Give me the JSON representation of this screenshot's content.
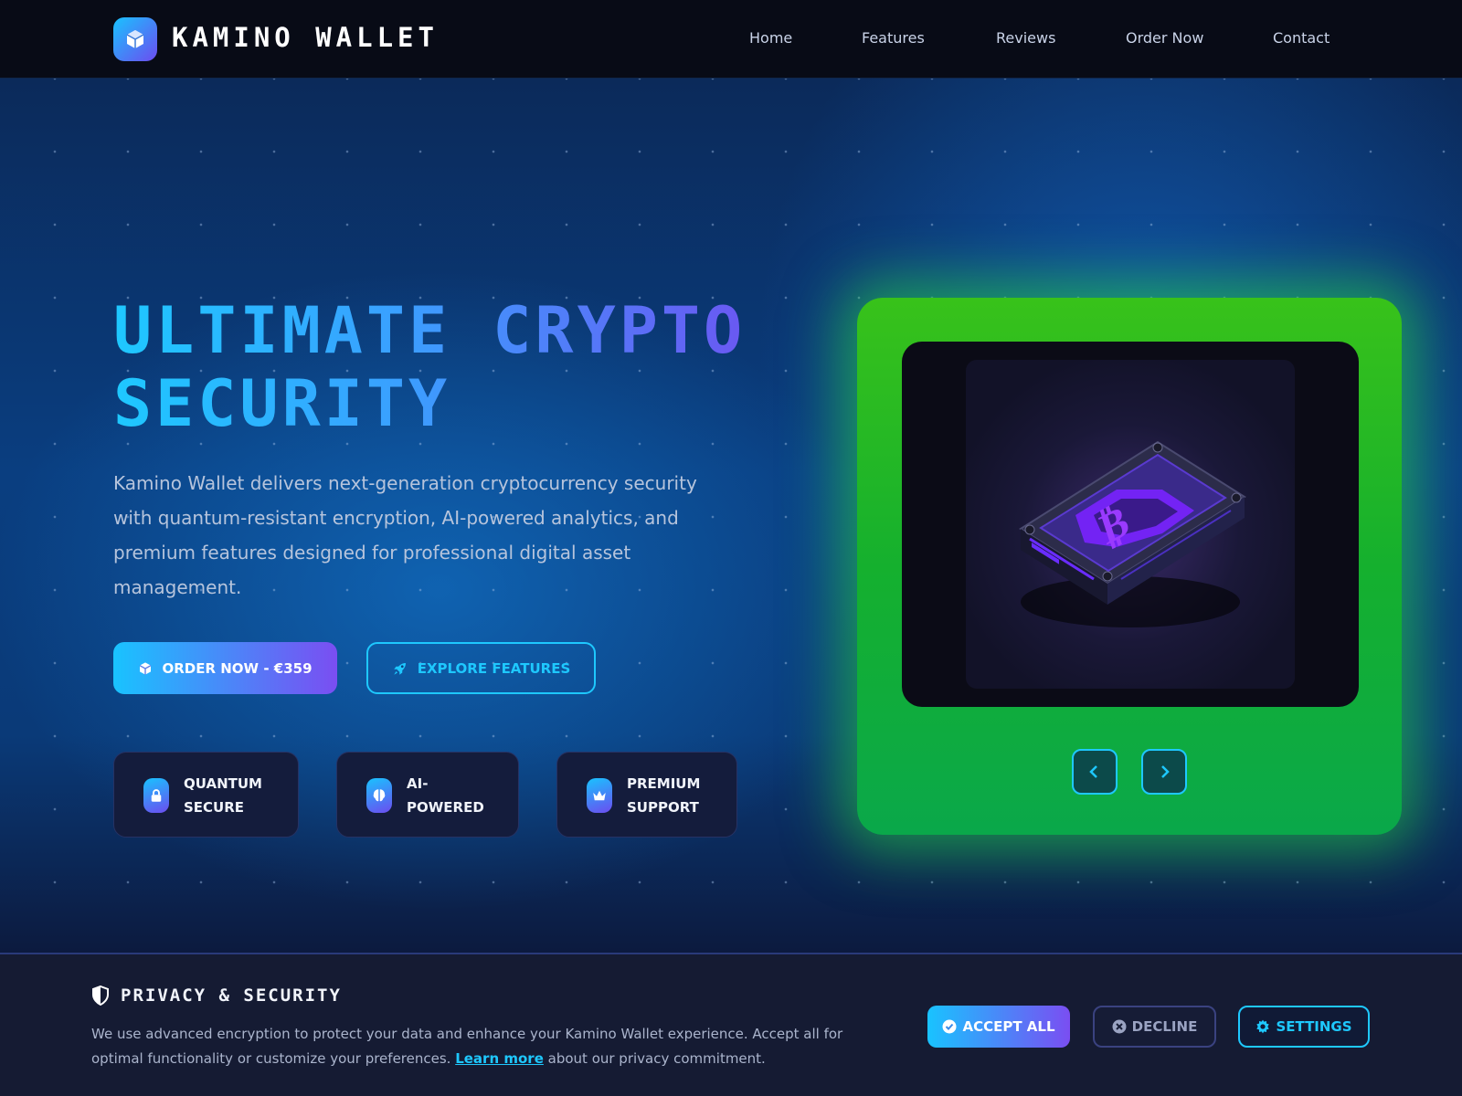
{
  "header": {
    "logo_text": "KAMINO WALLET",
    "nav": [
      "Home",
      "Features",
      "Reviews",
      "Order Now",
      "Contact"
    ]
  },
  "hero": {
    "title_line1": "ULTIMATE CRYPTO",
    "title_line2": "SECURITY",
    "description": "Kamino Wallet delivers next-generation cryptocurrency security with quantum-resistant encryption, AI-powered analytics, and premium features designed for professional digital asset management.",
    "order_button": "ORDER NOW - €359",
    "explore_button": "EXPLORE FEATURES",
    "features": [
      {
        "line1": "QUANTUM",
        "line2": "SECURE",
        "icon": "lock-icon"
      },
      {
        "line1": "AI-",
        "line2": "POWERED",
        "icon": "brain-icon"
      },
      {
        "line1": "PREMIUM",
        "line2": "SUPPORT",
        "icon": "crown-icon"
      }
    ]
  },
  "product": {
    "image_icon": "bitcoin-wallet-icon",
    "accent_glow": "#38c21a"
  },
  "banner": {
    "title": "PRIVACY & SECURITY",
    "text_before": "We use advanced encryption to protect your data and enhance your Kamino Wallet experience. Accept all for optimal functionality or customize your preferences. ",
    "link": "Learn more",
    "text_after": " about our privacy commitment.",
    "accept": "ACCEPT ALL",
    "decline": "DECLINE",
    "settings": "SETTINGS"
  },
  "colors": {
    "accent_cyan": "#1ec8ff",
    "accent_purple": "#6a58f2",
    "background": "#0a0d1c"
  }
}
